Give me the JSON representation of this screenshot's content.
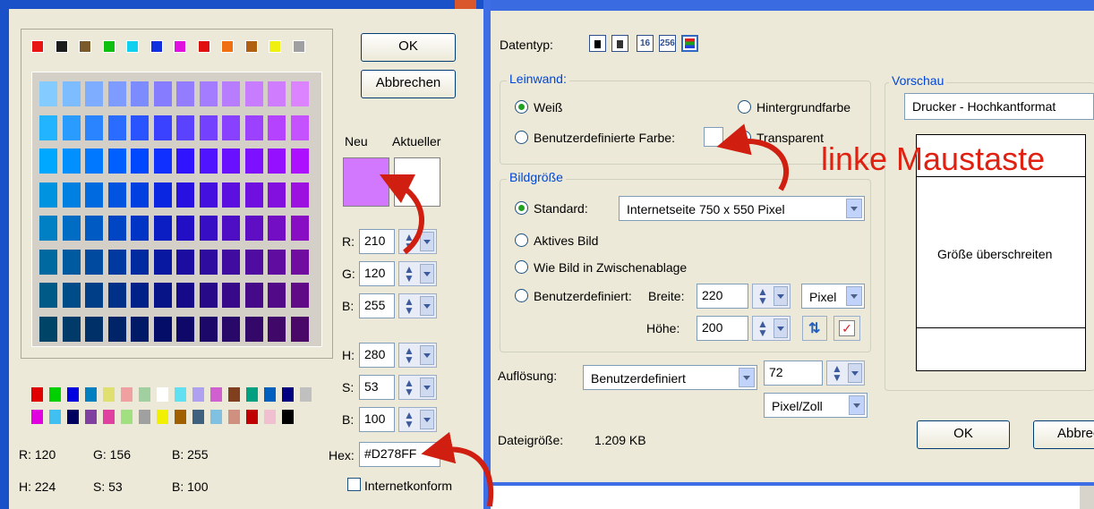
{
  "color_dialog": {
    "ok_label": "OK",
    "cancel_label": "Abbrechen",
    "new_label": "Neu",
    "current_label": "Aktueller",
    "new_color": "#D278FF",
    "current_color": "#FFFFFF",
    "fields": [
      {
        "label": "R:",
        "value": "210"
      },
      {
        "label": "G:",
        "value": "120"
      },
      {
        "label": "B:",
        "value": "255"
      },
      {
        "label": "H:",
        "value": "280"
      },
      {
        "label": "S:",
        "value": "53"
      },
      {
        "label": "B:",
        "value": "100"
      }
    ],
    "hex_label": "Hex:",
    "hex_value": "#D278FF",
    "web_safe_label": "Internetkonform",
    "info_row1": [
      "R: 120",
      "G: 156",
      "B: 255"
    ],
    "info_row2": [
      "H: 224",
      "S: 53",
      "B: 100"
    ],
    "mini_swatches": [
      "#e81313",
      "#1c1c1c",
      "#7a5a2a",
      "#10c010",
      "#10d0f0",
      "#1030e0",
      "#e010e0",
      "#e01010",
      "#f07010",
      "#b06010",
      "#f0f010",
      "#a0a0a0"
    ],
    "grid_rows": [
      [
        "#84ccff",
        "#7cbcff",
        "#7eacff",
        "#7e9cff",
        "#7c8cff",
        "#867cff",
        "#947cff",
        "#a47cff",
        "#b87cff",
        "#c87cff",
        "#d07cff",
        "#dc84ff"
      ],
      [
        "#22b4ff",
        "#2a9cff",
        "#2a84ff",
        "#2a6cff",
        "#2a54ff",
        "#3a42ff",
        "#5a42ff",
        "#7442ff",
        "#8842ff",
        "#9c42ff",
        "#b442ff",
        "#c452ff"
      ],
      [
        "#00a8ff",
        "#0090ff",
        "#0078ff",
        "#0060ff",
        "#0048ff",
        "#1030ff",
        "#3014ff",
        "#5014ff",
        "#6810ff",
        "#7c10ff",
        "#9410ff",
        "#ac10ff"
      ],
      [
        "#0094e0",
        "#0080e0",
        "#006ae0",
        "#0054e0",
        "#0040e0",
        "#0a26e0",
        "#2810e0",
        "#4410e0",
        "#5c10e0",
        "#7010e0",
        "#8410e0",
        "#9c10e0"
      ],
      [
        "#0080c4",
        "#006cc4",
        "#005ac4",
        "#0046c4",
        "#0034c4",
        "#0a1ec4",
        "#220ec4",
        "#380ec4",
        "#4e0ec4",
        "#600ec4",
        "#740ec4",
        "#880ec4"
      ],
      [
        "#006aa0",
        "#005aa0",
        "#004aa0",
        "#003aa0",
        "#002aa0",
        "#0818a0",
        "#1c0ca0",
        "#2e0ca0",
        "#400ca0",
        "#500ca0",
        "#600ca0",
        "#700ca0"
      ],
      [
        "#005a88",
        "#004c88",
        "#003e88",
        "#003088",
        "#002288",
        "#061488",
        "#160a88",
        "#260a88",
        "#360a88",
        "#440a88",
        "#520a88",
        "#600a88"
      ],
      [
        "#004468",
        "#003a68",
        "#003068",
        "#002468",
        "#001a68",
        "#040e68",
        "#100868",
        "#1c0868",
        "#280868",
        "#340868",
        "#400868",
        "#4a0868"
      ]
    ],
    "small_row1": [
      "#e00000",
      "#00d000",
      "#0000e0",
      "#0080c0",
      "#e0e070",
      "#f0a0a0",
      "#a0d0a0",
      "#ffffff",
      "#60e0f0",
      "#b0a0f0",
      "#d060d0",
      "#804020",
      "#00a080",
      "#0060c0",
      "#000080",
      "#c0c0c0"
    ],
    "small_row2": [
      "#e000e0",
      "#40c0f0",
      "#000060",
      "#8040a0",
      "#e040a0",
      "#a0e080",
      "#a0a0a0",
      "#f0f000",
      "#a06000",
      "#406080",
      "#80c0e0",
      "#d09080",
      "#c00000",
      "#f0c0d0",
      "#000000"
    ]
  },
  "image_dialog": {
    "datatype_label": "Datentyp:",
    "datatype_buttons": [
      "",
      "",
      "16",
      "256",
      ""
    ],
    "canvas_title": "Leinwand:",
    "opt_white": "Weiß",
    "opt_bgcolor": "Hintergrundfarbe",
    "opt_custom_color": "Benutzerdefinierte Farbe:",
    "opt_transparent": "Transparent",
    "size_title": "Bildgröße",
    "opt_standard": "Standard:",
    "standard_value": "Internetseite 750 x 550 Pixel",
    "opt_active": "Aktives Bild",
    "opt_clipboard": "Wie Bild in Zwischenablage",
    "opt_custom": "Benutzerdefiniert:",
    "width_label": "Breite:",
    "width_value": "220",
    "unit_value": "Pixel",
    "height_label": "Höhe:",
    "height_value": "200",
    "resolution_label": "Auflösung:",
    "resolution_mode": "Benutzerdefiniert",
    "resolution_value": "72",
    "resolution_unit": "Pixel/Zoll",
    "filesize_label": "Dateigröße:",
    "filesize_value": "1.209 KB",
    "preview_title": "Vorschau",
    "preview_combo": "Drucker - Hochkantformat",
    "preview_text": "Größe überschreiten",
    "ok_label": "OK",
    "cancel_label": "Abbrech"
  },
  "annotation": {
    "text": "linke Maustaste",
    "color": "#e02010"
  }
}
